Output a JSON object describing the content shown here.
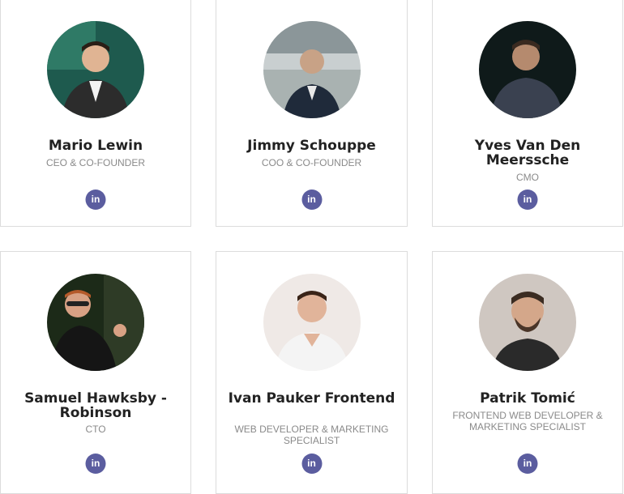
{
  "team": [
    {
      "name": "Mario Lewin",
      "role": "CEO & CO-FOUNDER",
      "social": "in"
    },
    {
      "name": "Jimmy Schouppe",
      "role": "COO & CO-FOUNDER",
      "social": "in"
    },
    {
      "name": "Yves Van Den Meerssche",
      "role": "CMO",
      "social": "in"
    },
    {
      "name": "Samuel Hawksby - Robinson",
      "role": "CTO",
      "social": "in"
    },
    {
      "name": "Ivan Pauker Frontend",
      "role": "WEB DEVELOPER & MARKETING SPECIALIST",
      "social": "in"
    },
    {
      "name": "Patrik Tomić",
      "role": "FRONTEND WEB DEVELOPER & MARKETING SPECIALIST",
      "social": "in"
    }
  ],
  "colors": {
    "linkedin": "#5b5d9f",
    "border": "#dcdcdc",
    "name": "#222222",
    "role": "#8a8a8a"
  }
}
